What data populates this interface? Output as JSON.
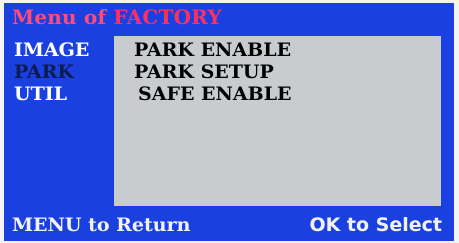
{
  "title": {
    "prefix": "Menu of ",
    "name": "FACTORY"
  },
  "sidebar": {
    "items": [
      {
        "label": "IMAGE",
        "state": "normal"
      },
      {
        "label": "PARK",
        "state": "selected"
      },
      {
        "label": "UTIL",
        "state": "normal"
      }
    ]
  },
  "content": {
    "items": [
      {
        "label": "PARK ENABLE"
      },
      {
        "label": "PARK SETUP"
      },
      {
        "label": "SAFE ENABLE"
      }
    ]
  },
  "footer": {
    "left": "MENU to Return",
    "right": "OK to Select"
  },
  "colors": {
    "screen_background": "#1a40e0",
    "panel_background": "#c9ccce",
    "title_color": "#ff3060",
    "selected_item_color": "#0d1a55",
    "normal_item_color": "#ffffff"
  }
}
